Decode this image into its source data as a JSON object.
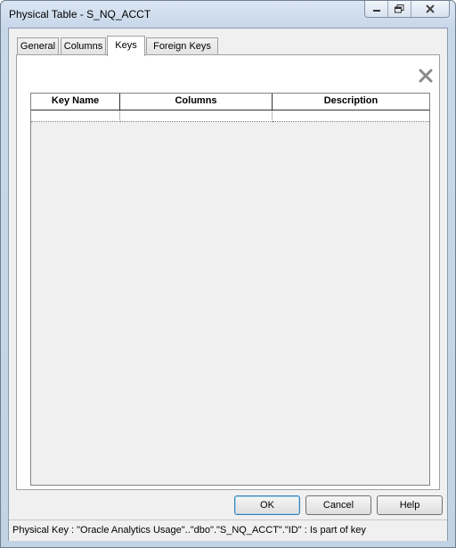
{
  "window": {
    "title": "Physical Table - S_NQ_ACCT",
    "caption_buttons": [
      "minimize-icon",
      "restore-icon",
      "close-icon"
    ]
  },
  "tabs": [
    {
      "label": "General",
      "active": false
    },
    {
      "label": "Columns",
      "active": false
    },
    {
      "label": "Keys",
      "active": true
    },
    {
      "label": "Foreign Keys",
      "active": false
    }
  ],
  "keys_panel": {
    "delete_icon": "delete-x-icon",
    "columns": [
      "Key Name",
      "Columns",
      "Description"
    ],
    "rows": [
      [
        "",
        "",
        ""
      ]
    ]
  },
  "buttons": {
    "ok": "OK",
    "cancel": "Cancel",
    "help": "Help"
  },
  "status": {
    "text": "Physical Key : \"Oracle Analytics Usage\"..\"dbo\".\"S_NQ_ACCT\".\"ID\" : Is part of key"
  },
  "colors": {
    "title_bar": "#c9d8ea",
    "dialog_bg": "#f0f0f0",
    "default_button_border": "#3c7fb1"
  }
}
